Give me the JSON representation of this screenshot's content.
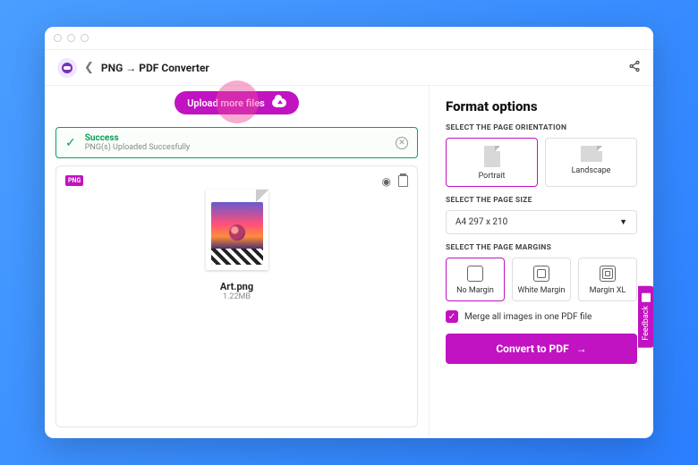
{
  "breadcrumb": {
    "from": "PNG",
    "arrow": "→",
    "to": "PDF Converter"
  },
  "upload": {
    "button_label": "Upload more files"
  },
  "success": {
    "title": "Success",
    "subtitle": "PNG(s) Uploaded Succesfully"
  },
  "file": {
    "badge": "PNG",
    "name": "Art.png",
    "size": "1.22MB"
  },
  "format": {
    "title": "Format options",
    "orientation_label": "SELECT THE PAGE ORIENTATION",
    "orientations": {
      "portrait": "Portrait",
      "landscape": "Landscape"
    },
    "pagesize_label": "SELECT THE PAGE SIZE",
    "pagesize_value": "A4 297 x 210",
    "margins_label": "SELECT THE PAGE MARGINS",
    "margins": {
      "none": "No Margin",
      "white": "White Margin",
      "xl": "Margin XL"
    },
    "merge_label": "Merge all images in one PDF file",
    "convert_label": "Convert to PDF"
  },
  "feedback": {
    "label": "Feedback"
  }
}
